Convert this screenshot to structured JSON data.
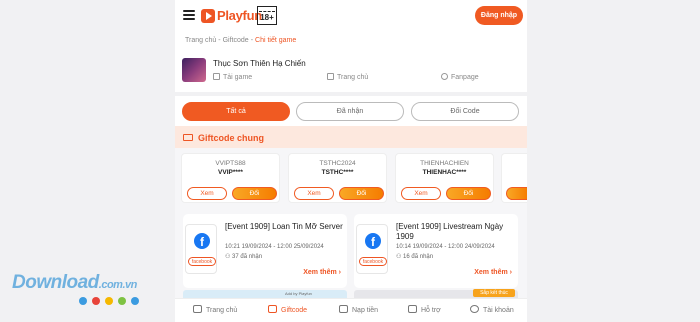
{
  "header": {
    "logo_text": "Playfun",
    "age_rating": "18+",
    "login_label": "Đăng nhập"
  },
  "breadcrumb": [
    "Trang chủ",
    "Giftcode",
    "Chi tiết game"
  ],
  "game": {
    "title": "Thục Sơn Thiên Hạ Chiến",
    "links": [
      "Tải game",
      "Trang chủ",
      "Fanpage"
    ]
  },
  "tabs": [
    "Tất cả",
    "Đã nhận",
    "Đổi Code"
  ],
  "section_title": "Giftcode chung",
  "codes": [
    {
      "name": "VVIPTS88",
      "code": "VVIP****",
      "view": "Xem",
      "swap": "Đổi"
    },
    {
      "name": "TSTHC2024",
      "code": "TSTHC****",
      "view": "Xem",
      "swap": "Đổi"
    },
    {
      "name": "THIENHACHIEN",
      "code": "THIENHAC****",
      "view": "Xem",
      "swap": "Đổi"
    },
    {
      "name": "",
      "code": "",
      "view": "",
      "swap": ""
    }
  ],
  "events": [
    {
      "tag": "facebook",
      "title": "[Event 1909] Loan Tin Mỡ Server",
      "time": "10:21 19/09/2024 - 12:00 25/09/2024",
      "count": "37 đã nhận",
      "more": "Xem thêm"
    },
    {
      "tag": "facebook",
      "title": "[Event 1909] Livestream Ngày 1909",
      "time": "10:14 19/09/2024 - 12:00 24/09/2024",
      "count": "16 đã nhận",
      "more": "Xem thêm"
    }
  ],
  "peek": {
    "badge": "Sắp kết thúc",
    "tiny": "Add by Playfun"
  },
  "bottom_nav": [
    "Trang chủ",
    "Giftcode",
    "Nạp tiền",
    "Hỗ trợ",
    "Tài khoản"
  ],
  "watermark": {
    "main": "Download",
    "suffix": ".com.vn"
  },
  "colors": {
    "accent": "#ee5524",
    "dots": [
      "#3b9be0",
      "#e8443a",
      "#f5b800",
      "#7ec242",
      "#3b9be0"
    ]
  }
}
